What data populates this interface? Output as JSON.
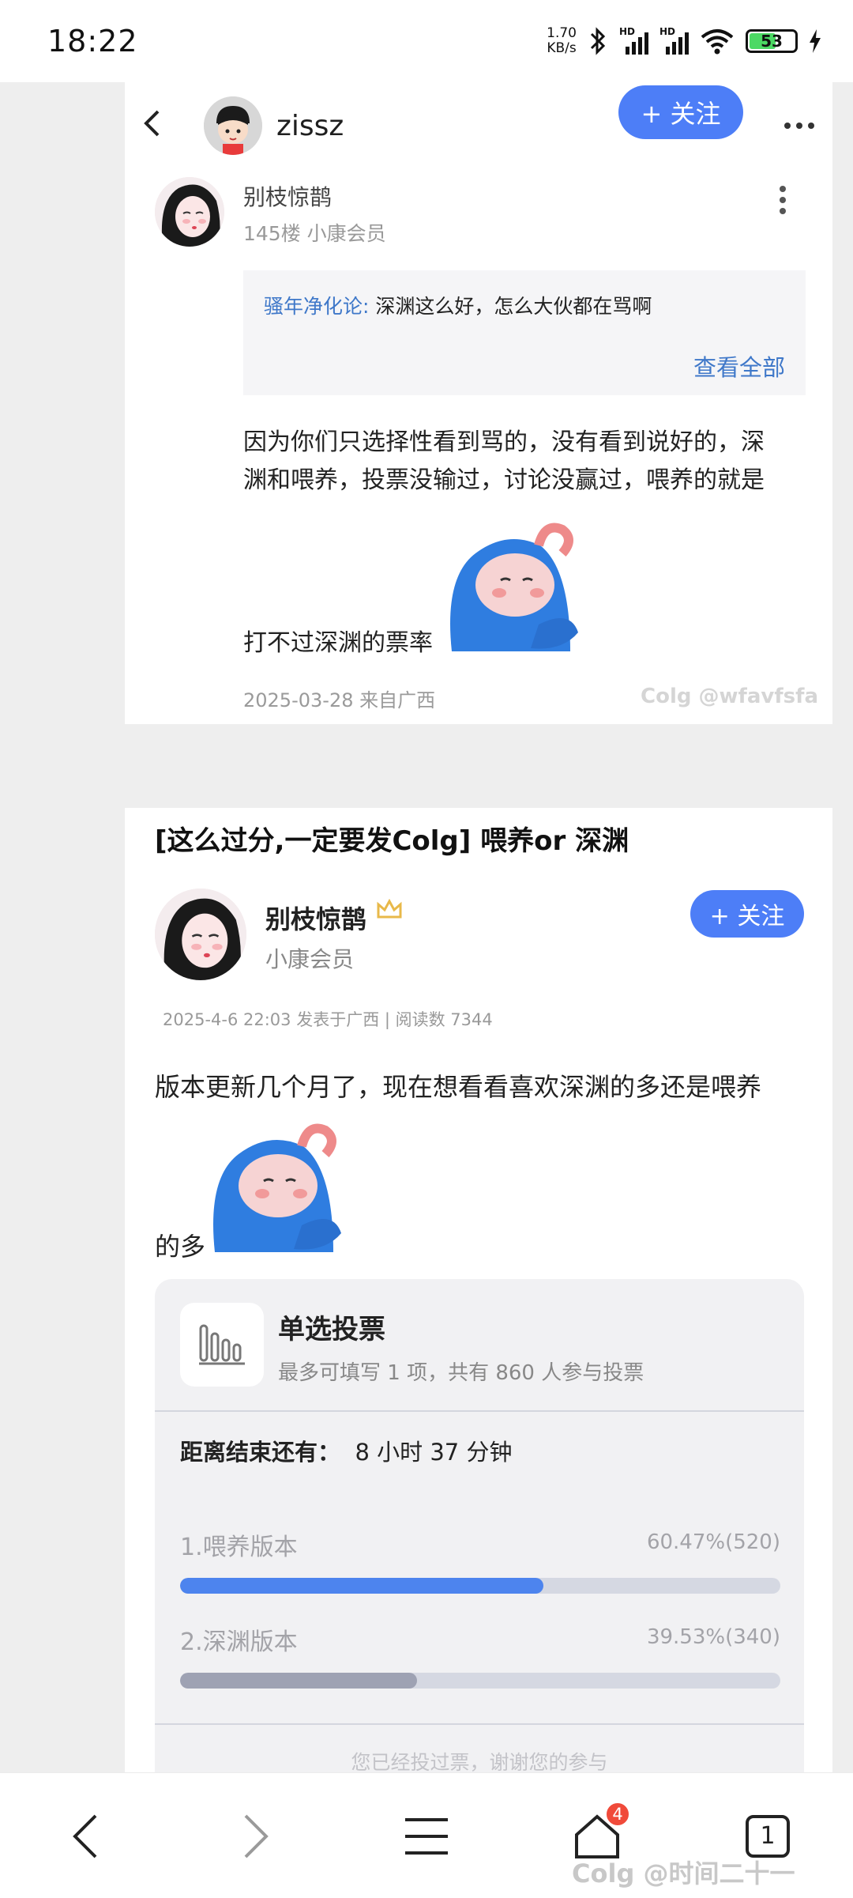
{
  "status_bar": {
    "time": "18:22",
    "net_speed_value": "1.70",
    "net_speed_unit": "KB/s",
    "signal1_label": "HD",
    "signal2_label": "HD",
    "battery_level": "53"
  },
  "top_nav": {
    "back_icon": "chevron-left-icon",
    "username": "zissz",
    "follow_label": "+ 关注",
    "more_icon": "more-horizontal-icon"
  },
  "reply": {
    "username": "别枝惊鹊",
    "floor_and_rank": "145楼 小康会员",
    "quote_author": "骚年净化论:",
    "quote_text": " 深渊这么好，怎么大伙都在骂啊",
    "see_all": "查看全部",
    "body_line1": "因为你们只选择性看到骂的，没有看到说好的，深",
    "body_line2": "渊和喂养，投票没输过，讨论没赢过，喂养的就是",
    "body_line3": "打不过深渊的票率",
    "meta": "2025-03-28 来自广西",
    "watermark": "Colg @wfavfsfa"
  },
  "post": {
    "title": "[这么过分,一定要发Colg] 喂养or 深渊",
    "username": "别枝惊鹊",
    "rank": "小康会员",
    "follow_label": "+ 关注",
    "meta": "2025-4-6 22:03 发表于广西 | 阅读数 7344",
    "content_line1": "版本更新几个月了，现在想看看喜欢深渊的多还是喂养",
    "content_line2": "的多"
  },
  "vote": {
    "title": "单选投票",
    "subtitle": "最多可填写 1 项，共有 860 人参与投票",
    "countdown_label": "距离结束还有：",
    "countdown_value": "8 小时 37 分钟",
    "options": [
      {
        "label": "1.喂养版本",
        "result": "60.47%(520)",
        "fraction": 0.6047,
        "color": "#4d84ee"
      },
      {
        "label": "2.深渊版本",
        "result": "39.53%(340)",
        "fraction": 0.3953,
        "color": "#9ea2b3"
      }
    ],
    "voted_text": "您已经投过票，谢谢您的参与"
  },
  "bottom_nav": {
    "back_icon": "chevron-left-icon",
    "forward_icon": "chevron-right-icon",
    "menu_icon": "menu-icon",
    "home_icon": "home-icon",
    "home_badge": "4",
    "tabs_count": "1",
    "watermark": "Colg @时间二十一"
  }
}
